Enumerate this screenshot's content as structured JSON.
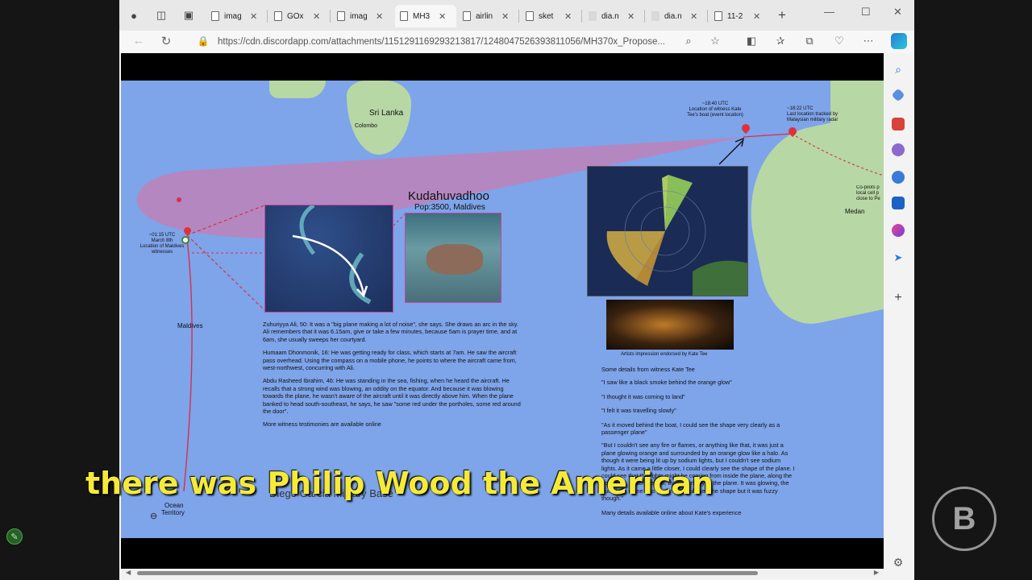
{
  "browser": {
    "tabs": [
      {
        "label": "imag"
      },
      {
        "label": "GOx"
      },
      {
        "label": "imag"
      },
      {
        "label": "MH3",
        "active": true
      },
      {
        "label": "airlin"
      },
      {
        "label": "sket"
      },
      {
        "label": "dia.n"
      },
      {
        "label": "dia.n"
      },
      {
        "label": "11-2"
      }
    ],
    "url": "https://cdn.discordapp.com/attachments/1151291169293213817/1248047526393811056/MH370x_Propose..."
  },
  "map": {
    "places": {
      "sri_lanka": "Sri Lanka",
      "colombo": "Colombo",
      "maldives": "Maldives",
      "medan": "Medan",
      "ocean": "Ocean",
      "territory": "Territory",
      "diego_garcia": "Diego Garcia Military Base"
    },
    "kudahuvadhoo_title": "Kudahuvadhoo",
    "kudahuvadhoo_pop": "Pop:3500, Maldives",
    "maldives_witness": [
      "~01:15 UTC",
      "March 8th",
      "Location of Maldives",
      "witnesses"
    ],
    "kate_tee_location": [
      "~18:40 UTC",
      "Location of witness Kate",
      "Tee's boat (event location)"
    ],
    "radar_location": [
      "~18:22 UTC",
      "Last location tracked by",
      "Malaysian military radar"
    ],
    "copilot_note": [
      "Co-pilots p",
      "local cell p",
      "close to Pe"
    ],
    "maldives_testimonies": [
      "Zuhuriyya Ali, 50: It was a \"big plane making a lot of noise\", she says. She draws an arc in the sky. Ali remembers that it was 6.15am, give or take a few minutes, because 5am is prayer time, and at 6am, she usually sweeps her courtyard.",
      "Humaam Dhonmonik, 16: He was getting ready for class, which starts at 7am. He saw the aircraft pass overhead. Using the compass on a mobile phone, he points to where the aircraft came from, west-northwest, concurring with Ali.",
      "Abdu Rasheed Ibrahim, 46: He was standing in the sea, fishing, when he heard the aircraft. He recalls that a strong wind was blowing, an oddity on the equator. And because it was blowing towards the plane, he wasn't aware of the aircraft until it was directly above him. When the plane banked to head south-southeast, he says, he saw \"some red under the portholes, some red around the door\".",
      "More witness testimonies are available online"
    ],
    "kate_caption": "Artists impression endorsed by Kate Tee",
    "kate_details_title": "Some details from witness Kate Tee",
    "kate_quotes": [
      "\"I saw like a black smoke behind the orange glow\"",
      "\"I thought it was coming to land\"",
      "\"I felt it was travelling slowly\"",
      "\"As it moved behind the boat, I could see the shape very clearly as a passenger plane\"",
      "\"But I couldn't see any fire or flames, or anything like that, it was just a plane glowing orange and surrounded by an orange glow like a halo. As though it were being lit up by sodium lights, but I couldn't see sodium lights. As it came a little closer, I could clearly see the shape of the plane. I could see that the lights might be coming from inside the plane, along the portholes, under the hull, the underbelly of the plane. It was glowing, the hull of the plane was glowing, I could see the shape but it was fuzzy though.\"",
      "Many details available online about Kate's experience"
    ]
  },
  "video": {
    "caption": "there was Philip Wood the American",
    "channel_logo_letter": "B"
  },
  "colors": {
    "ocean": "#7ea4ea",
    "land": "#b7d7a5",
    "cone": "#c47fb4",
    "route": "#d6304a",
    "caption": "#f5e93a"
  }
}
